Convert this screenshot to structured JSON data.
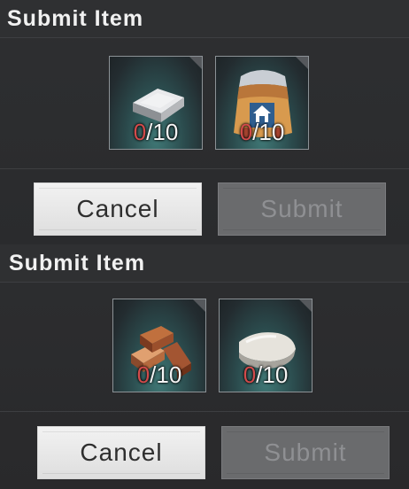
{
  "dialogs": [
    {
      "title": "Submit Item",
      "items": [
        {
          "icon": "iron-ingot-icon",
          "have": "0",
          "need": "/10"
        },
        {
          "icon": "flour-sack-icon",
          "have": "0",
          "need": "/10"
        }
      ],
      "cancel_label": "Cancel",
      "submit_label": "Submit"
    },
    {
      "title": "Submit Item",
      "items": [
        {
          "icon": "wood-planks-icon",
          "have": "0",
          "need": "/10"
        },
        {
          "icon": "stone-slab-icon",
          "have": "0",
          "need": "/10"
        }
      ],
      "cancel_label": "Cancel",
      "submit_label": "Submit"
    }
  ],
  "colors": {
    "count_missing": "#d24b4b",
    "slot_glow": "#3f7775"
  }
}
